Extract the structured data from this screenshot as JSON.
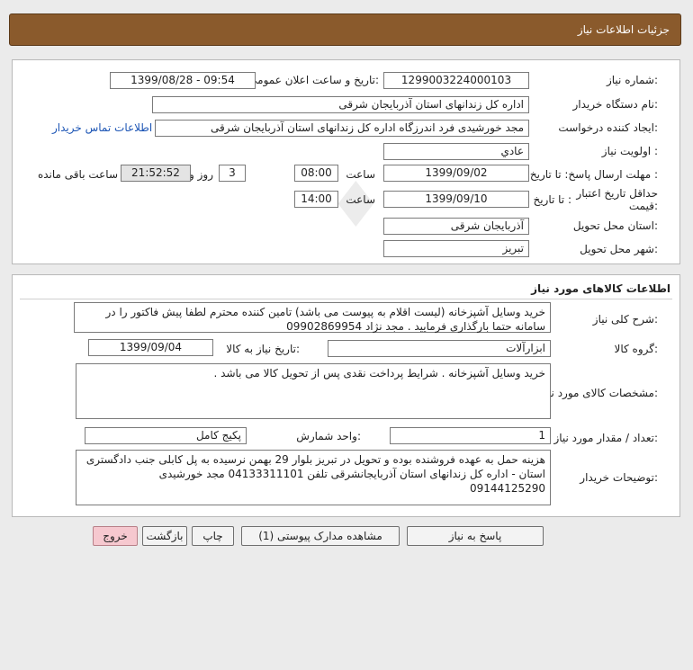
{
  "header": {
    "title": "جزئیات اطلاعات نیاز"
  },
  "info": {
    "need_number_label": "شماره نیاز:",
    "need_number": "1299003224000103",
    "announce_label": "تاریخ و ساعت اعلان عمومی:",
    "announce_value": "1399/08/28 - 09:54",
    "buyer_label": "نام دستگاه خریدار:",
    "buyer": "اداره کل زندانهای استان آذربایجان شرقی",
    "creator_label": "ایجاد کننده درخواست:",
    "creator": "مجد خورشیدی فرد اندرزگاه اداره کل زندانهای استان آذربایجان شرقی",
    "contact_link": "اطلاعات تماس خریدار",
    "priority_label": "اولویت نیاز :",
    "priority": "عادي",
    "deadline_label": "مهلت ارسال پاسخ:  تا تاریخ :",
    "deadline_date": "1399/09/02",
    "time_label": "ساعت",
    "deadline_time": "08:00",
    "days_value": "3",
    "days_label": "روز و",
    "remaining_time": "21:52:52",
    "remaining_label": "ساعت باقی مانده",
    "validity_label": "حداقل تاریخ اعتبار قیمت:",
    "validity_to_label": "تا تاریخ :",
    "validity_date": "1399/09/10",
    "validity_time": "14:00",
    "province_label": "استان محل تحویل:",
    "province": "آذربایجان شرقی",
    "city_label": "شهر محل تحویل:",
    "city": "تبریز"
  },
  "goods": {
    "section_title": "اطلاعات کالاهای مورد نیاز",
    "summary_label": "شرح کلی نیاز:",
    "summary": "خرید وسایل آشپزخانه (لیست اقلام به پیوست می باشد) تامین کننده  محترم لطفا پیش فاکتور را در سامانه حتما بارگذاری فرمایید . مجد نژاد 09902869954",
    "group_label": "گروه کالا:",
    "group": "ابزارآلات",
    "need_date_label": "تاریخ نیاز به کالا:",
    "need_date": "1399/09/04",
    "spec_label": "مشخصات کالای مورد نیاز:",
    "spec": "خرید وسایل آشپزخانه . شرایط پرداخت نقدی پس از تحویل کالا می باشد .",
    "qty_label": "تعداد / مقدار مورد نیاز:",
    "qty": "1",
    "unit_label": "واحد شمارش:",
    "unit": "پکیج کامل",
    "buyer_notes_label": "توضیحات خریدار:",
    "buyer_notes": "هزینه حمل به عهده فروشنده بوده و تحویل در تبریز بلوار 29 بهمن نرسیده به پل کابلی جنب دادگستری استان - اداره کل زندانهای استان آذربایجانشرقی تلفن 04133311101 مجد خورشیدی 09144125290"
  },
  "buttons": {
    "reply": "پاسخ به نیاز",
    "attachments": "مشاهده مدارک پیوستی (1)",
    "print": "چاپ",
    "back": "بازگشت",
    "exit": "خروج"
  }
}
